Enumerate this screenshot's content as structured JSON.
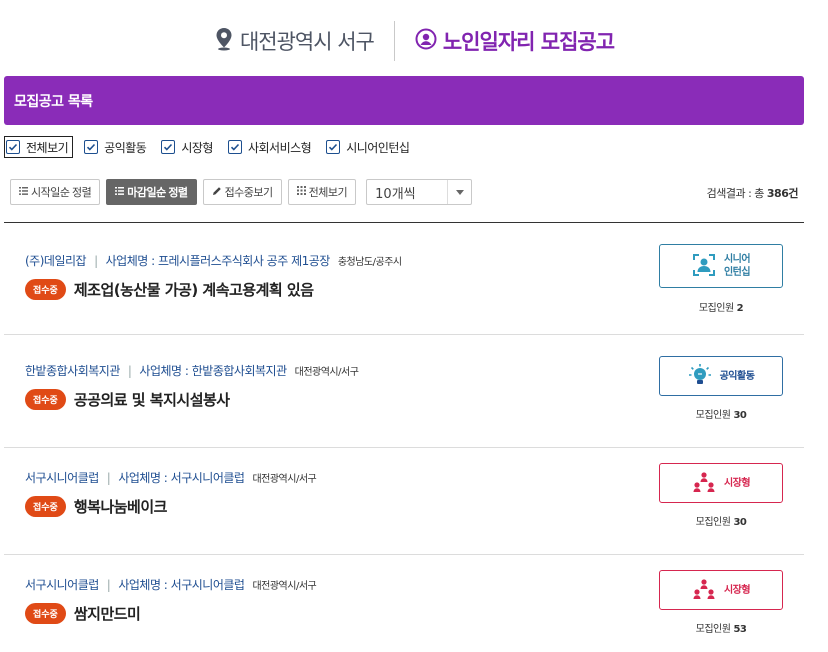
{
  "header": {
    "region": "대전광역시 서구",
    "title": "노인일자리 모집공고",
    "pin_color": "#4e5564",
    "title_color": "#8124b0"
  },
  "title_bar": {
    "label": "모집공고 목록",
    "color": "#8a2cb8"
  },
  "filters": [
    {
      "label": "전체보기",
      "checked": true
    },
    {
      "label": "공익활동",
      "checked": true
    },
    {
      "label": "시장형",
      "checked": true
    },
    {
      "label": "사회서비스형",
      "checked": true
    },
    {
      "label": "시니어인턴십",
      "checked": true
    }
  ],
  "toolbar": {
    "sort_start_label": "시작일순 정렬",
    "sort_deadline_label": "마감일순 정렬",
    "open_only_label": "접수중보기",
    "view_all_label": "전체보기",
    "per_page_value": "10개씩",
    "result_prefix": "검색결과 : 총",
    "result_count": "386건"
  },
  "jobs": [
    {
      "org": "(주)데일리잡",
      "company": "사업체명 : 프레시플러스주식회사 공주 제1공장",
      "region": "충청남도/공주시",
      "status": "접수중",
      "title": "제조업(농산물 가공) 계속고용계획 있음",
      "type_label": "시니어 인턴십",
      "type_icon": "intern-icon",
      "recruit_label": "모집인원",
      "recruit_count": "2"
    },
    {
      "org": "한밭종합사회복지관",
      "company": "사업체명 : 한밭종합사회복지관",
      "region": "대전광역시/서구",
      "status": "접수중",
      "title": "공공의료 및 복지시설봉사",
      "type_label": "공익활동",
      "type_icon": "lightbulb-icon",
      "recruit_label": "모집인원",
      "recruit_count": "30"
    },
    {
      "org": "서구시니어클럽",
      "company": "사업체명 : 서구시니어클럽",
      "region": "대전광역시/서구",
      "status": "접수중",
      "title": "행복나눔베이크",
      "type_label": "시장형",
      "type_icon": "people-icon",
      "recruit_label": "모집인원",
      "recruit_count": "30"
    },
    {
      "org": "서구시니어클럽",
      "company": "사업체명 : 서구시니어클럽",
      "region": "대전광역시/서구",
      "status": "접수중",
      "title": "쌈지만드미",
      "type_label": "시장형",
      "type_icon": "people-icon",
      "recruit_label": "모집인원",
      "recruit_count": "53"
    }
  ],
  "colors": {
    "badge": "#e04a16",
    "link": "#1f4e91",
    "intern": "#2f7ea3",
    "market": "#d6264f"
  }
}
